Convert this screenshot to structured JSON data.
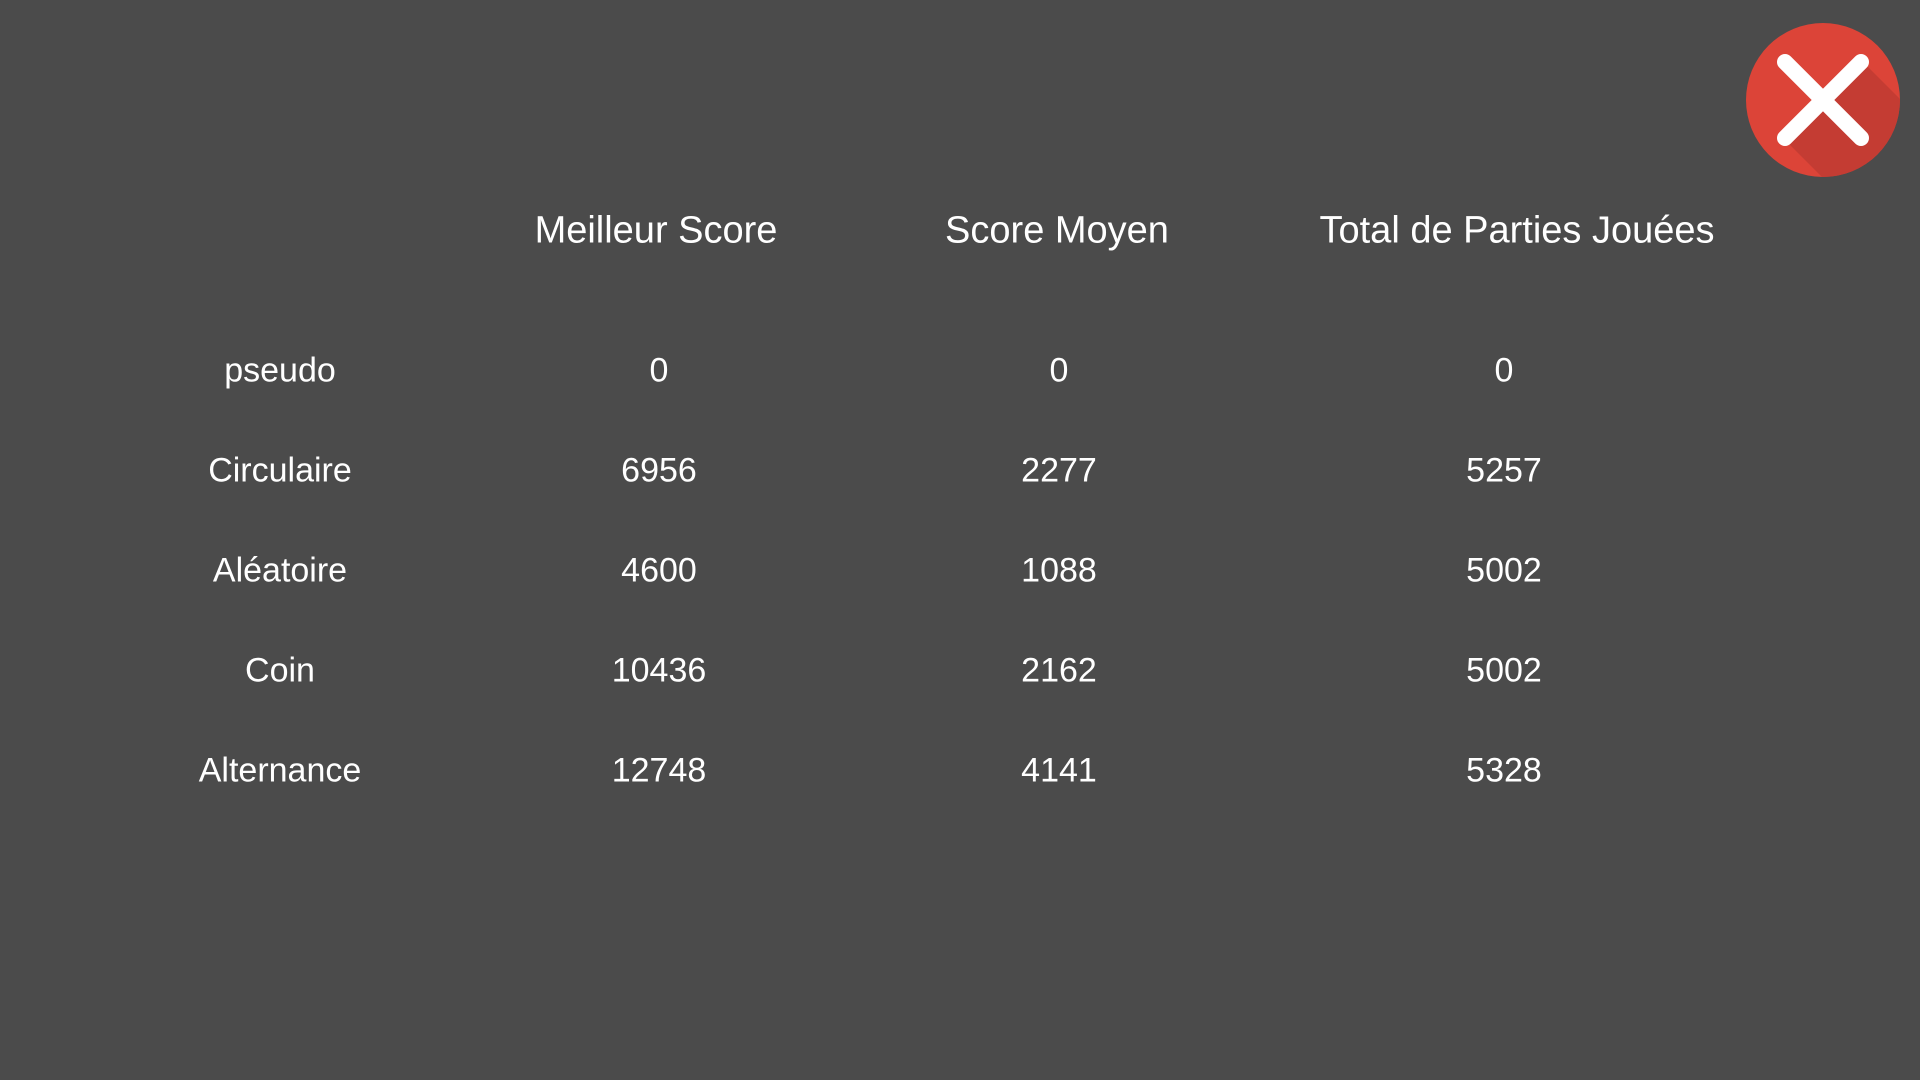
{
  "close_button": {
    "icon": "close-icon",
    "colors": {
      "circle": "#dc4438",
      "shadow": "#bf3b32",
      "cross": "#ffffff"
    }
  },
  "table": {
    "columns": [
      "Meilleur Score",
      "Score Moyen",
      "Total de Parties Jouées"
    ],
    "rows": [
      {
        "label": "pseudo",
        "values": [
          "0",
          "0",
          "0"
        ]
      },
      {
        "label": "Circulaire",
        "values": [
          "6956",
          "2277",
          "5257"
        ]
      },
      {
        "label": "Aléatoire",
        "values": [
          "4600",
          "1088",
          "5002"
        ]
      },
      {
        "label": "Coin",
        "values": [
          "10436",
          "2162",
          "5002"
        ]
      },
      {
        "label": "Alternance",
        "values": [
          "12748",
          "4141",
          "5328"
        ]
      }
    ]
  },
  "colors": {
    "background": "#4b4b4b",
    "text": "#ffffff"
  }
}
